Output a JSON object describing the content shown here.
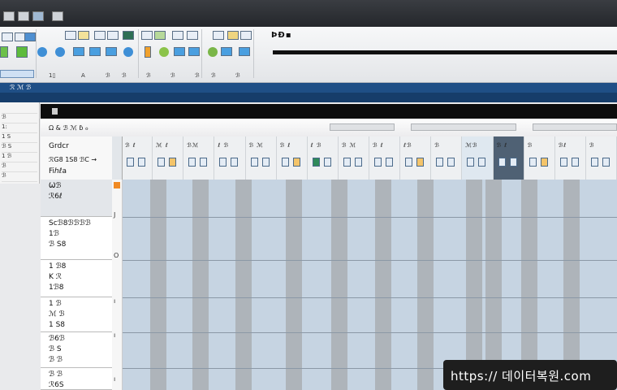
{
  "ribbon": {
    "brand_text": "ÞÐ▪",
    "row_labels": [
      "1▯",
      "A",
      "ℬ",
      "ℬ",
      "ℬ",
      "ℬ",
      "ℬ",
      "ℬ",
      "ℬ"
    ]
  },
  "panel": {
    "header_label": "ℛ ℳ ℬ",
    "mini_rows": [
      "",
      "ℬ",
      "1:",
      "1 S",
      "ℬ S",
      "1 ℬ",
      "ℬ",
      "ℬ"
    ]
  },
  "sheet": {
    "header_lines": [
      "Grdcr",
      "ℛG8 1S8 ℬC →",
      "Fiℎℓa"
    ],
    "toolbar_text": [
      "Ω & ℬ ℳ ɓ ℴ"
    ],
    "columns": [
      {
        "t": "ℬ ℓ"
      },
      {
        "t": "ℳ ℓ"
      },
      {
        "t": "ℬℳ"
      },
      {
        "t": "ℓ ℬ"
      },
      {
        "t": "ℬ ℳ"
      },
      {
        "t": "ℬ ℓ"
      },
      {
        "t": "ℓ ℬ"
      },
      {
        "t": "ℬ ℳ"
      },
      {
        "t": "ℬ ℓ"
      },
      {
        "t": "ℓℬ"
      },
      {
        "t": "ℬ"
      },
      {
        "t": "ℳℬ"
      },
      {
        "t": "ℬ ℓ"
      },
      {
        "t": "ℬ"
      },
      {
        "t": "ℬℓ"
      },
      {
        "t": "ℬ"
      }
    ],
    "rows": [
      {
        "lines": [
          "Ѡℬ",
          "ℛ6ℓ"
        ]
      },
      {
        "lines": [
          "Scℬ8ℬℬℬℬ",
          "1ℬ",
          "ℬ S8"
        ]
      },
      {
        "lines": [
          "1 ℬ8",
          "K ℛ",
          "1ℬ8"
        ]
      },
      {
        "lines": [
          "1 ℬ",
          "ℳ ℬ",
          "1 S8"
        ]
      },
      {
        "lines": [
          "ℬ6ℬ",
          "ℬ S",
          "ℬ ℬ"
        ]
      },
      {
        "lines": [
          "ℬ ℬ",
          "ℛ6S"
        ]
      }
    ]
  },
  "watermark": {
    "text": "https:// 데이터복원.com"
  },
  "colors": {
    "accent": "#1f4f86",
    "grid": "#c6d4e2",
    "stripe": "#aeb4ba"
  }
}
